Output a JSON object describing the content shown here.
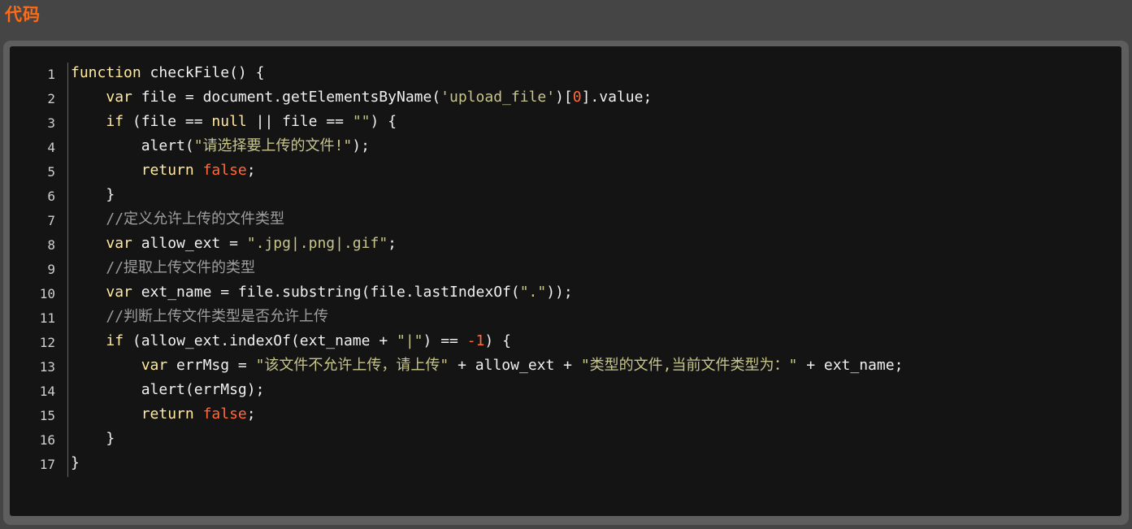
{
  "header": {
    "title": "代码"
  },
  "code": {
    "line_numbers": [
      "1",
      "2",
      "3",
      "4",
      "5",
      "6",
      "7",
      "8",
      "9",
      "10",
      "11",
      "12",
      "13",
      "14",
      "15",
      "16",
      "17"
    ],
    "lines": [
      [
        {
          "t": "kw",
          "s": "function"
        },
        {
          "t": "op",
          "s": " checkFile() {"
        }
      ],
      [
        {
          "t": "op",
          "s": "    "
        },
        {
          "t": "kw",
          "s": "var"
        },
        {
          "t": "op",
          "s": " file = document.getElementsByName("
        },
        {
          "t": "str",
          "s": "'upload_file'"
        },
        {
          "t": "op",
          "s": ")["
        },
        {
          "t": "num",
          "s": "0"
        },
        {
          "t": "op",
          "s": "].value;"
        }
      ],
      [
        {
          "t": "op",
          "s": "    "
        },
        {
          "t": "kw",
          "s": "if"
        },
        {
          "t": "op",
          "s": " (file == "
        },
        {
          "t": "kw",
          "s": "null"
        },
        {
          "t": "op",
          "s": " || file == "
        },
        {
          "t": "str",
          "s": "\"\""
        },
        {
          "t": "op",
          "s": ") {"
        }
      ],
      [
        {
          "t": "op",
          "s": "        alert("
        },
        {
          "t": "str",
          "s": "\"请选择要上传的文件!\""
        },
        {
          "t": "op",
          "s": ");"
        }
      ],
      [
        {
          "t": "op",
          "s": "        "
        },
        {
          "t": "kw",
          "s": "return"
        },
        {
          "t": "op",
          "s": " "
        },
        {
          "t": "num",
          "s": "false"
        },
        {
          "t": "op",
          "s": ";"
        }
      ],
      [
        {
          "t": "op",
          "s": "    }"
        }
      ],
      [
        {
          "t": "op",
          "s": "    "
        },
        {
          "t": "com",
          "s": "//定义允许上传的文件类型"
        }
      ],
      [
        {
          "t": "op",
          "s": "    "
        },
        {
          "t": "kw",
          "s": "var"
        },
        {
          "t": "op",
          "s": " allow_ext = "
        },
        {
          "t": "str",
          "s": "\".jpg|.png|.gif\""
        },
        {
          "t": "op",
          "s": ";"
        }
      ],
      [
        {
          "t": "op",
          "s": "    "
        },
        {
          "t": "com",
          "s": "//提取上传文件的类型"
        }
      ],
      [
        {
          "t": "op",
          "s": "    "
        },
        {
          "t": "kw",
          "s": "var"
        },
        {
          "t": "op",
          "s": " ext_name = file.substring(file.lastIndexOf("
        },
        {
          "t": "str",
          "s": "\".\""
        },
        {
          "t": "op",
          "s": "));"
        }
      ],
      [
        {
          "t": "op",
          "s": "    "
        },
        {
          "t": "com",
          "s": "//判断上传文件类型是否允许上传"
        }
      ],
      [
        {
          "t": "op",
          "s": "    "
        },
        {
          "t": "kw",
          "s": "if"
        },
        {
          "t": "op",
          "s": " (allow_ext.indexOf(ext_name + "
        },
        {
          "t": "str",
          "s": "\"|\""
        },
        {
          "t": "op",
          "s": ") == "
        },
        {
          "t": "num",
          "s": "-1"
        },
        {
          "t": "op",
          "s": ") {"
        }
      ],
      [
        {
          "t": "op",
          "s": "        "
        },
        {
          "t": "kw",
          "s": "var"
        },
        {
          "t": "op",
          "s": " errMsg = "
        },
        {
          "t": "str",
          "s": "\"该文件不允许上传，请上传\""
        },
        {
          "t": "op",
          "s": " + allow_ext + "
        },
        {
          "t": "str",
          "s": "\"类型的文件,当前文件类型为：\""
        },
        {
          "t": "op",
          "s": " + ext_name;"
        }
      ],
      [
        {
          "t": "op",
          "s": "        alert(errMsg);"
        }
      ],
      [
        {
          "t": "op",
          "s": "        "
        },
        {
          "t": "kw",
          "s": "return"
        },
        {
          "t": "op",
          "s": " "
        },
        {
          "t": "num",
          "s": "false"
        },
        {
          "t": "op",
          "s": ";"
        }
      ],
      [
        {
          "t": "op",
          "s": "    }"
        }
      ],
      [
        {
          "t": "op",
          "s": "}"
        }
      ]
    ]
  },
  "colors": {
    "title": "#ff6a13",
    "background": "#454545",
    "panel": "#141414",
    "keyword": "#ffe9a0",
    "string": "#c8c58a",
    "number": "#ff6a3d",
    "comment": "#9e9e9e"
  }
}
